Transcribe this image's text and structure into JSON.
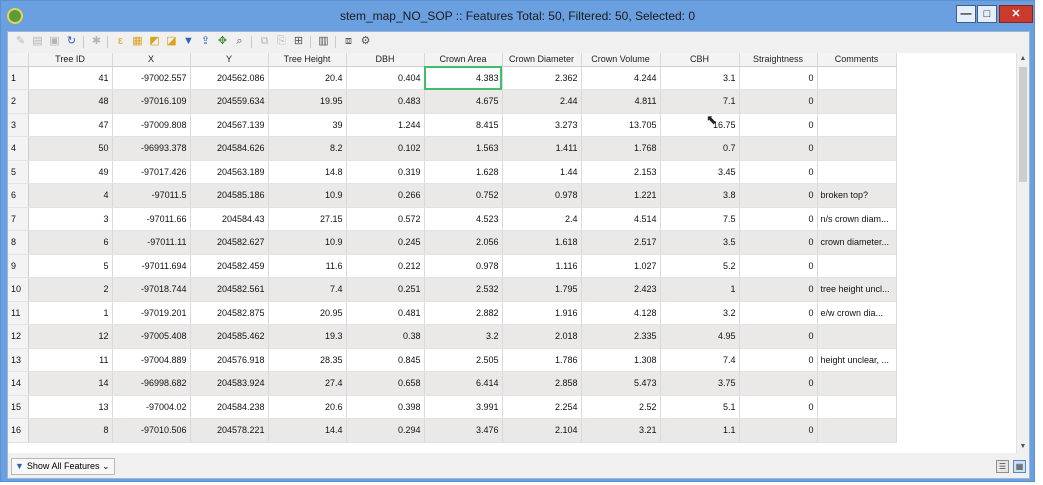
{
  "window": {
    "title": "stem_map_NO_SOP :: Features Total: 50, Filtered: 50, Selected: 0",
    "controls": {
      "minimize": "—",
      "maximize": "□",
      "close": "✕"
    }
  },
  "toolbar": {
    "icons": [
      "pencil-icon",
      "save-edits-icon",
      "reload-icon",
      "add-feature-icon",
      "delete-feature-icon",
      "cut-icon",
      "copy-icon",
      "paste-icon",
      "select-by-expression-icon",
      "select-all-icon",
      "invert-selection-icon",
      "deselect-all-icon",
      "filter-icon",
      "move-selection-top-icon",
      "pan-to-selected-icon",
      "zoom-to-selected-icon",
      "new-field-icon",
      "delete-field-icon",
      "field-calculator-icon",
      "conditional-formatting-icon",
      "dock-icon",
      "actions-icon"
    ]
  },
  "table": {
    "columns": [
      "Tree ID",
      "X",
      "Y",
      "Tree Height",
      "DBH",
      "Crown Area",
      "Crown Diameter",
      "Crown Volume",
      "CBH",
      "Straightness",
      "Comments"
    ],
    "rows": [
      {
        "n": "1",
        "c": [
          "41",
          "-97002.557",
          "204562.086",
          "20.4",
          "0.404",
          "4.383",
          "2.362",
          "4.244",
          "3.1",
          "0",
          ""
        ]
      },
      {
        "n": "2",
        "c": [
          "48",
          "-97016.109",
          "204559.634",
          "19.95",
          "0.483",
          "4.675",
          "2.44",
          "4.811",
          "7.1",
          "0",
          ""
        ]
      },
      {
        "n": "3",
        "c": [
          "47",
          "-97009.808",
          "204567.139",
          "39",
          "1.244",
          "8.415",
          "3.273",
          "13.705",
          "16.75",
          "0",
          ""
        ]
      },
      {
        "n": "4",
        "c": [
          "50",
          "-96993.378",
          "204584.626",
          "8.2",
          "0.102",
          "1.563",
          "1.411",
          "1.768",
          "0.7",
          "0",
          ""
        ]
      },
      {
        "n": "5",
        "c": [
          "49",
          "-97017.426",
          "204563.189",
          "14.8",
          "0.319",
          "1.628",
          "1.44",
          "2.153",
          "3.45",
          "0",
          ""
        ]
      },
      {
        "n": "6",
        "c": [
          "4",
          "-97011.5",
          "204585.186",
          "10.9",
          "0.266",
          "0.752",
          "0.978",
          "1.221",
          "3.8",
          "0",
          "broken top?"
        ]
      },
      {
        "n": "7",
        "c": [
          "3",
          "-97011.66",
          "204584.43",
          "27.15",
          "0.572",
          "4.523",
          "2.4",
          "4.514",
          "7.5",
          "0",
          "n/s crown diam..."
        ]
      },
      {
        "n": "8",
        "c": [
          "6",
          "-97011.11",
          "204582.627",
          "10.9",
          "0.245",
          "2.056",
          "1.618",
          "2.517",
          "3.5",
          "0",
          "crown diameter..."
        ]
      },
      {
        "n": "9",
        "c": [
          "5",
          "-97011.694",
          "204582.459",
          "11.6",
          "0.212",
          "0.978",
          "1.116",
          "1.027",
          "5.2",
          "0",
          ""
        ]
      },
      {
        "n": "10",
        "c": [
          "2",
          "-97018.744",
          "204582.561",
          "7.4",
          "0.251",
          "2.532",
          "1.795",
          "2.423",
          "1",
          "0",
          "tree height uncl..."
        ]
      },
      {
        "n": "11",
        "c": [
          "1",
          "-97019.201",
          "204582.875",
          "20.95",
          "0.481",
          "2.882",
          "1.916",
          "4.128",
          "3.2",
          "0",
          "e/w crown dia..."
        ]
      },
      {
        "n": "12",
        "c": [
          "12",
          "-97005.408",
          "204585.462",
          "19.3",
          "0.38",
          "3.2",
          "2.018",
          "2.335",
          "4.95",
          "0",
          ""
        ]
      },
      {
        "n": "13",
        "c": [
          "11",
          "-97004.889",
          "204576.918",
          "28.35",
          "0.845",
          "2.505",
          "1.786",
          "1.308",
          "7.4",
          "0",
          "height unclear, ..."
        ]
      },
      {
        "n": "14",
        "c": [
          "14",
          "-96998.682",
          "204583.924",
          "27.4",
          "0.658",
          "6.414",
          "2.858",
          "5.473",
          "3.75",
          "0",
          ""
        ]
      },
      {
        "n": "15",
        "c": [
          "13",
          "-97004.02",
          "204584.238",
          "20.6",
          "0.398",
          "3.991",
          "2.254",
          "2.52",
          "5.1",
          "0",
          ""
        ]
      },
      {
        "n": "16",
        "c": [
          "8",
          "-97010.506",
          "204578.221",
          "14.4",
          "0.294",
          "3.476",
          "2.104",
          "3.21",
          "1.1",
          "0",
          ""
        ]
      }
    ],
    "selected_cell": {
      "row": 0,
      "col": 5
    }
  },
  "bottom": {
    "filter_label": "Show All Features",
    "view_icons": [
      "form-view-icon",
      "table-view-icon"
    ]
  }
}
